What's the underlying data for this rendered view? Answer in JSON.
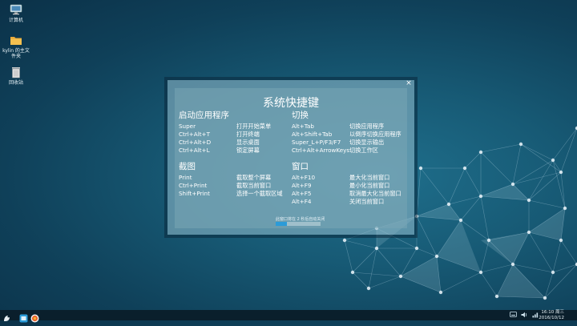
{
  "desktop": {
    "icons": [
      {
        "label": "计算机",
        "icon": "computer-icon"
      },
      {
        "label": "kylin 的主文件夹",
        "icon": "folder-icon"
      },
      {
        "label": "回收站",
        "icon": "trash-icon"
      }
    ]
  },
  "dialog": {
    "title": "系统快捷键",
    "close_glyph": "×",
    "sections": {
      "launch": {
        "title": "启动应用程序",
        "rows": [
          {
            "key": "Super",
            "desc": "打开开始菜单"
          },
          {
            "key": "Ctrl+Alt+T",
            "desc": "打开终端"
          },
          {
            "key": "Ctrl+Alt+D",
            "desc": "显示桌面"
          },
          {
            "key": "Ctrl+Alt+L",
            "desc": "锁定屏幕"
          }
        ]
      },
      "switch": {
        "title": "切换",
        "rows": [
          {
            "key": "Alt+Tab",
            "desc": "切换应用程序"
          },
          {
            "key": "Alt+Shift+Tab",
            "desc": "以倒序切换应用程序"
          },
          {
            "key": "Super_L+P/F3/F7",
            "desc": "切换显示输出"
          },
          {
            "key": "Ctrl+Alt+ArrowKeys",
            "desc": "切换工作区"
          }
        ]
      },
      "screenshot": {
        "title": "截图",
        "rows": [
          {
            "key": "Print",
            "desc": "截取整个屏幕"
          },
          {
            "key": "Ctrl+Print",
            "desc": "截取当前窗口"
          },
          {
            "key": "Shift+Print",
            "desc": "选择一个截取区域"
          }
        ]
      },
      "window": {
        "title": "窗口",
        "rows": [
          {
            "key": "Alt+F10",
            "desc": "最大化当前窗口"
          },
          {
            "key": "Alt+F9",
            "desc": "最小化当前窗口"
          },
          {
            "key": "Alt+F5",
            "desc": "取消最大化当前窗口"
          },
          {
            "key": "Alt+F4",
            "desc": "关闭当前窗口"
          }
        ]
      }
    },
    "auto_close_text": "此窗口将在 2 秒后自动关闭",
    "progress": 0.25
  },
  "taskbar": {
    "clock_time": "16:10 周三",
    "clock_date": "2016/10/12",
    "start_icon": "kylin-start-icon",
    "apps": [
      "file-manager-icon",
      "browser-icon"
    ],
    "tray": [
      "keyboard-icon",
      "volume-icon",
      "network-icon"
    ]
  },
  "colors": {
    "accent": "#2b9bd8",
    "taskbar": "#0a1f2c"
  }
}
